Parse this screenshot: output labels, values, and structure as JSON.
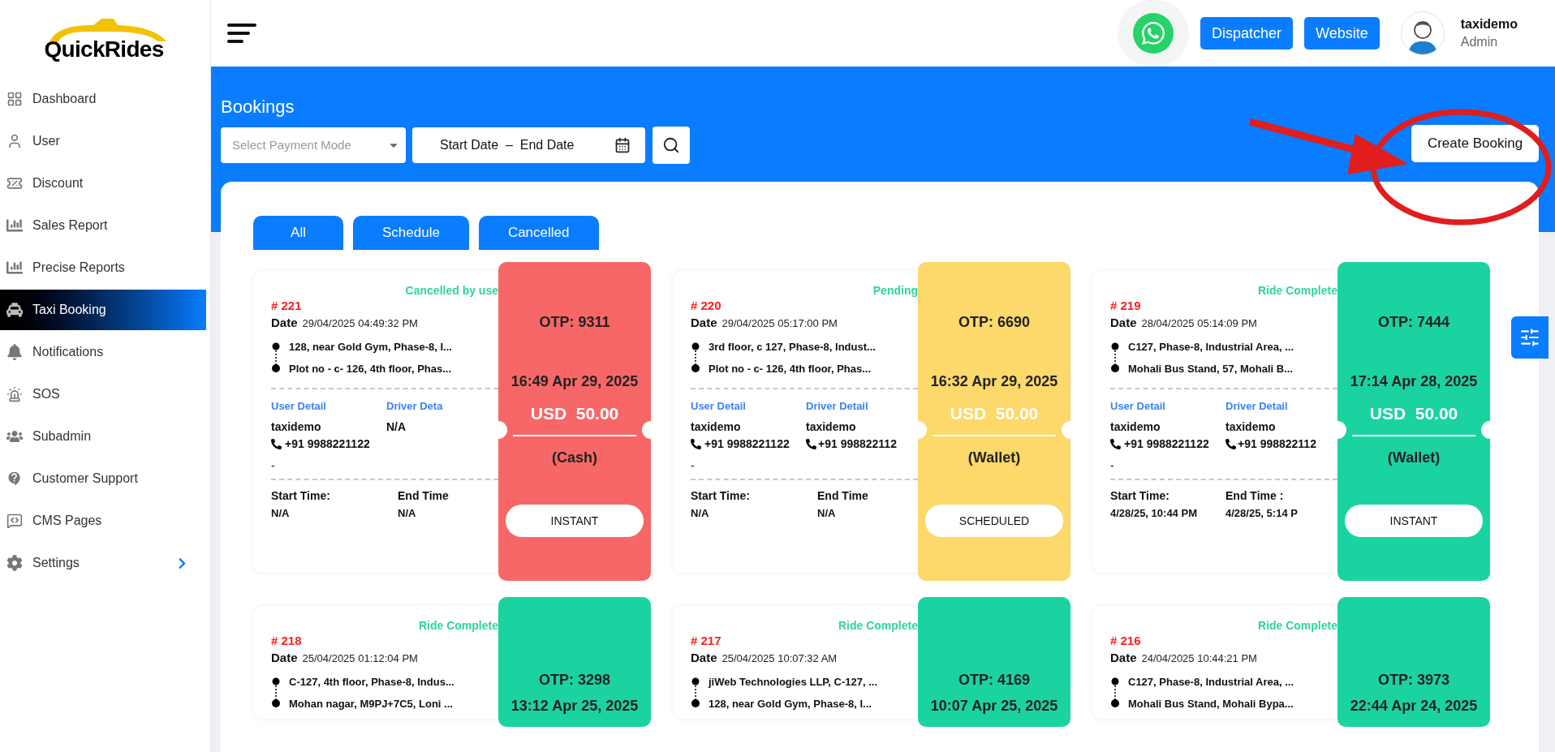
{
  "sidebar": {
    "logo": "QuickRides",
    "items": [
      {
        "label": "Dashboard",
        "selected": false,
        "expandable": false
      },
      {
        "label": "User",
        "selected": false,
        "expandable": false
      },
      {
        "label": "Discount",
        "selected": false,
        "expandable": false
      },
      {
        "label": "Sales Report",
        "selected": false,
        "expandable": false
      },
      {
        "label": "Precise Reports",
        "selected": false,
        "expandable": false
      },
      {
        "label": "Taxi Booking",
        "selected": true,
        "expandable": false
      },
      {
        "label": "Notifications",
        "selected": false,
        "expandable": false
      },
      {
        "label": "SOS",
        "selected": false,
        "expandable": false
      },
      {
        "label": "Subadmin",
        "selected": false,
        "expandable": false
      },
      {
        "label": "Customer Support",
        "selected": false,
        "expandable": false
      },
      {
        "label": "CMS Pages",
        "selected": false,
        "expandable": false
      },
      {
        "label": "Settings",
        "selected": false,
        "expandable": true
      }
    ]
  },
  "header": {
    "buttons": [
      "Dispatcher",
      "Website"
    ],
    "user": {
      "name": "taxidemo",
      "role": "Admin"
    }
  },
  "page": {
    "title": "Bookings",
    "payment_select": {
      "placeholder": "Select Payment Mode"
    },
    "date_range": {
      "value": "Start Date  –  End Date"
    },
    "create_button": "Create Booking"
  },
  "tabs": [
    {
      "label": "All",
      "selected": false
    },
    {
      "label": "Schedule",
      "selected": false
    },
    {
      "label": "Cancelled",
      "selected": false
    }
  ],
  "bookings": [
    {
      "status": "Cancelled by use",
      "id": "# 221",
      "date_label": "Date",
      "date": "29/04/2025 04:49:32 PM",
      "pickup": "128, near Gold Gym, Phase-8, I...",
      "drop": "Plot no - c- 126, 4th floor, Phas...",
      "user_label": "User Detail",
      "driver_label": "Driver Deta",
      "user_name": "taxidemo",
      "user_phone": "+91 9988221122",
      "driver_name": "N/A",
      "note": "-",
      "start_label": "Start Time:",
      "end_label": "End Time",
      "start": "N/A",
      "end": "N/A",
      "otp": "OTP: 9311",
      "time": "16:49 Apr 29, 2025",
      "amount": "USD  50.00",
      "payment": "(Cash)",
      "ride_type": "INSTANT",
      "color": "#f76767"
    },
    {
      "status": "Pending",
      "id": "# 220",
      "date_label": "Date",
      "date": "29/04/2025 05:17:00 PM",
      "pickup": "3rd floor, c 127, Phase-8, Indust...",
      "drop": "Plot no - c- 126, 4th floor, Phas...",
      "user_label": "User Detail",
      "driver_label": "Driver Detail",
      "user_name": "taxidemo",
      "user_phone": "+91 9988221122",
      "driver_name": "taxidemo",
      "driver_phone": "+91 998822112",
      "note": "-",
      "start_label": "Start Time:",
      "end_label": "End Time",
      "start": "N/A",
      "end": "N/A",
      "otp": "OTP: 6690",
      "time": "16:32 Apr 29, 2025",
      "amount": "USD  50.00",
      "payment": "(Wallet)",
      "ride_type": "SCHEDULED",
      "color": "#fdd86b"
    },
    {
      "status": "Ride Complete",
      "id": "# 219",
      "date_label": "Date",
      "date": "28/04/2025 05:14:09 PM",
      "pickup": "C127, Phase-8, Industrial Area, ...",
      "drop": "Mohali Bus Stand, 57, Mohali B...",
      "user_label": "User Detail",
      "driver_label": "Driver Detail",
      "user_name": "taxidemo",
      "user_phone": "+91 9988221122",
      "driver_name": "taxidemo",
      "driver_phone": "+91 998822112",
      "note": "-",
      "start_label": "Start Time:",
      "end_label": "End Time :",
      "start": "4/28/25, 10:44 PM",
      "end": "4/28/25, 5:14 P",
      "otp": "OTP: 7444",
      "time": "17:14 Apr 28, 2025",
      "amount": "USD  50.00",
      "payment": "(Wallet)",
      "ride_type": "INSTANT",
      "color": "#1bd3a0"
    },
    {
      "status": "Ride Complete",
      "id": "# 218",
      "date_label": "Date",
      "date": "25/04/2025 01:12:04 PM",
      "pickup": "C-127, 4th floor, Phase-8, Indus...",
      "drop": "Mohan nagar, M9PJ+7C5, Loni ...",
      "otp": "OTP: 3298",
      "time": "13:12 Apr 25, 2025",
      "color": "#1bd3a0"
    },
    {
      "status": "Ride Complete",
      "id": "# 217",
      "date_label": "Date",
      "date": "25/04/2025 10:07:32 AM",
      "pickup": "jiWeb Technologies LLP, C-127, ...",
      "drop": "128, near Gold Gym, Phase-8, I...",
      "otp": "OTP: 4169",
      "time": "10:07 Apr 25, 2025",
      "color": "#1bd3a0"
    },
    {
      "status": "Ride Complete",
      "id": "# 216",
      "date_label": "Date",
      "date": "24/04/2025 10:44:21 PM",
      "pickup": "C127, Phase-8, Industrial Area, ...",
      "drop": "Mohali Bus Stand, Mohali Bypa...",
      "otp": "OTP: 3973",
      "time": "22:44 Apr 24, 2025",
      "color": "#1bd3a0"
    }
  ]
}
